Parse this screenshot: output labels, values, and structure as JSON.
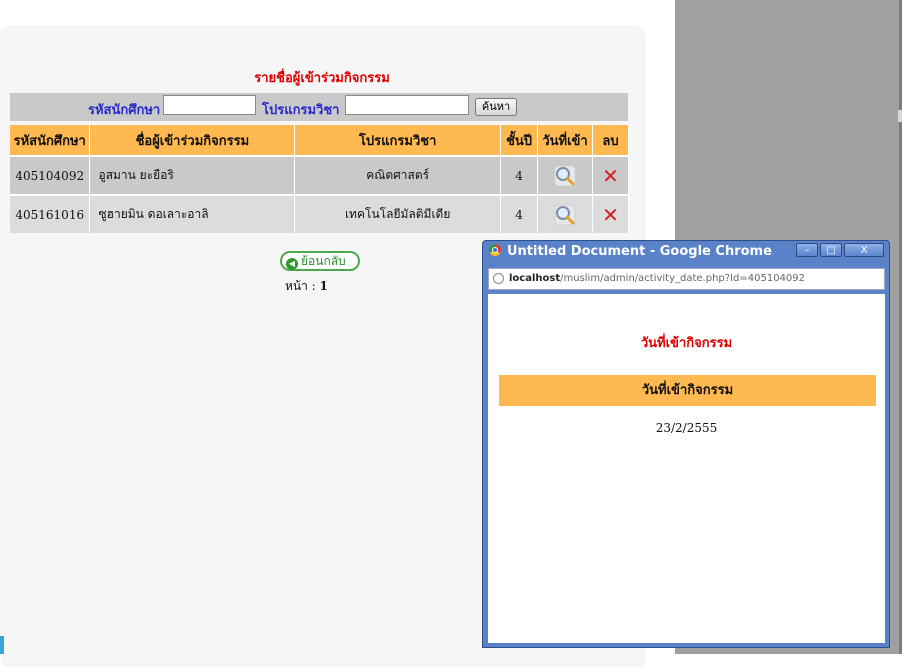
{
  "page": {
    "title": "รายชื่อผู้เข้าร่วมกิจกรรม",
    "search": {
      "student_id_label": "รหัสนักศึกษา",
      "program_label": "โปรแกรมวิชา",
      "student_id_value": "",
      "program_value": "",
      "button_label": "ค้นหา"
    },
    "table": {
      "headers": [
        "รหัสนักศึกษา",
        "ชื่อผู้เข้าร่วมกิจกรรม",
        "โปรแกรมวิชา",
        "ชั้นปี",
        "วันที่เข้า",
        "ลบ"
      ],
      "rows": [
        {
          "student_id": "405104092",
          "name": "อูสมาน ยะยือริ",
          "program": "คณิตศาสตร์",
          "year": "4",
          "view_icon": "magnifier-icon",
          "delete_icon": "delete-x-icon"
        },
        {
          "student_id": "405161016",
          "name": "ซูฮายมิน ดอเลาะอาลิ",
          "program": "เทคโนโลยีมัลติมีเดีย",
          "year": "4",
          "view_icon": "magnifier-icon",
          "delete_icon": "delete-x-icon"
        }
      ]
    },
    "back_label": "ย้อนกลับ",
    "pager_label": "หน้า :",
    "pager_value": "1"
  },
  "popup": {
    "window_title": "Untitled Document - Google Chrome",
    "url_host": "localhost",
    "url_path": "/muslim/admin/activity_date.php?Id=405104092",
    "heading": "วันที่เข้ากิจกรรม",
    "column_header": "วันที่เข้ากิจกรรม",
    "date_value": "23/2/2555",
    "buttons": {
      "minimize": "–",
      "maximize": "□",
      "close": "X"
    }
  },
  "colors": {
    "header_orange": "#ffb950",
    "title_red": "#e00000",
    "label_blue": "#2a2ac8",
    "popup_frame_blue": "#5a82c8"
  }
}
